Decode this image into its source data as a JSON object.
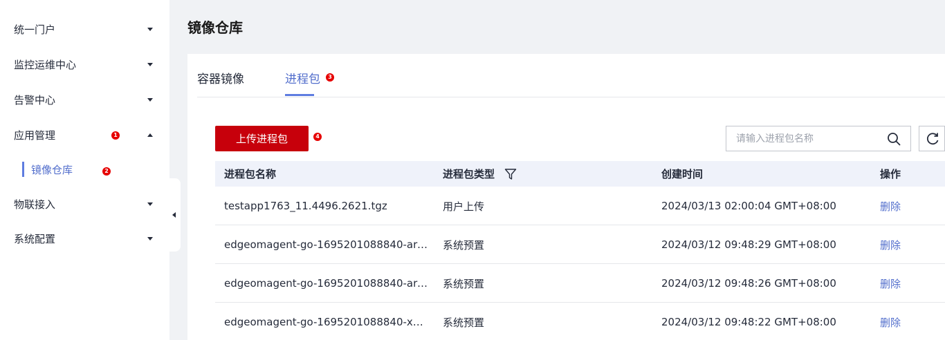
{
  "sidebar": {
    "items": [
      {
        "label": "统一门户",
        "expanded": false
      },
      {
        "label": "监控运维中心",
        "expanded": false
      },
      {
        "label": "告警中心",
        "expanded": false
      },
      {
        "label": "应用管理",
        "expanded": true
      },
      {
        "label": "物联接入",
        "expanded": false
      },
      {
        "label": "系统配置",
        "expanded": false
      }
    ],
    "sub_item": {
      "label": "镜像仓库",
      "active": true
    }
  },
  "markers": [
    "1",
    "2",
    "3",
    "4"
  ],
  "page": {
    "title": "镜像仓库"
  },
  "tabs": [
    {
      "label": "容器镜像",
      "active": false
    },
    {
      "label": "进程包",
      "active": true
    }
  ],
  "toolbar": {
    "upload_label": "上传进程包",
    "search_placeholder": "请输入进程包名称"
  },
  "table": {
    "columns": [
      "进程包名称",
      "进程包类型",
      "创建时间",
      "操作"
    ],
    "rows": [
      {
        "name": "testapp1763_11.4496.2621.tgz",
        "type": "用户上传",
        "time": "2024/03/13 02:00:04 GMT+08:00",
        "action": "删除"
      },
      {
        "name": "edgeomagent-go-1695201088840-arm…",
        "type": "系统预置",
        "time": "2024/03/12 09:48:29 GMT+08:00",
        "action": "删除"
      },
      {
        "name": "edgeomagent-go-1695201088840-arm…",
        "type": "系统预置",
        "time": "2024/03/12 09:48:26 GMT+08:00",
        "action": "删除"
      },
      {
        "name": "edgeomagent-go-1695201088840-x86…",
        "type": "系统预置",
        "time": "2024/03/12 09:48:22 GMT+08:00",
        "action": "删除"
      }
    ]
  },
  "colors": {
    "brand_red": "#c7000b",
    "accent_blue": "#5e7ce0",
    "link_blue": "#526ecc",
    "marker_red": "#e60000"
  },
  "icons": {
    "search": "search-icon",
    "refresh": "refresh-icon",
    "filter": "filter-icon",
    "collapse": "collapse-sidebar-icon"
  }
}
